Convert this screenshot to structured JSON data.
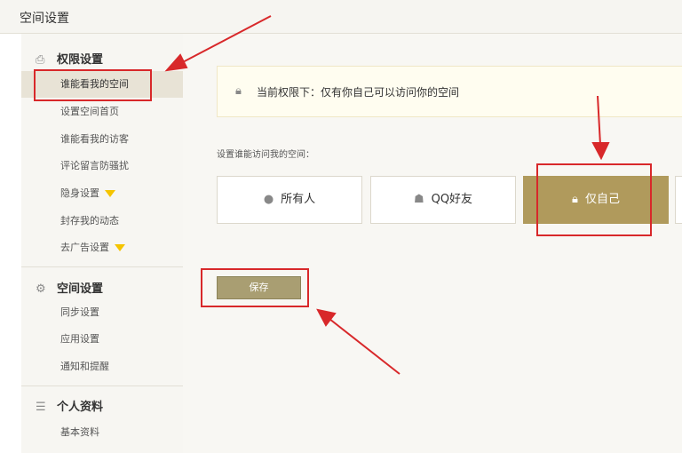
{
  "window": {
    "title": "空间设置"
  },
  "sidebar": {
    "sections": [
      {
        "title": "权限设置",
        "icon": "printer-icon",
        "items": [
          {
            "label": "谁能看我的空间",
            "active": true
          },
          {
            "label": "设置空间首页"
          },
          {
            "label": "谁能看我的访客"
          },
          {
            "label": "评论留言防骚扰"
          },
          {
            "label": "隐身设置",
            "badge": "diamond-icon"
          },
          {
            "label": "封存我的动态"
          },
          {
            "label": "去广告设置",
            "badge": "diamond-icon"
          }
        ]
      },
      {
        "title": "空间设置",
        "icon": "gear-icon",
        "items": [
          {
            "label": "同步设置"
          },
          {
            "label": "应用设置"
          },
          {
            "label": "通知和提醒"
          }
        ]
      },
      {
        "title": "个人资料",
        "icon": "user-list-icon",
        "items": [
          {
            "label": "基本资料"
          }
        ]
      }
    ]
  },
  "main": {
    "notice": {
      "icon": "lock-icon",
      "text": "当前权限下：仅有你自己可以访问你的空间"
    },
    "prompt": "设置谁能访问我的空间：",
    "options": [
      {
        "label": "所有人",
        "icon": "globe-icon",
        "selected": false
      },
      {
        "label": "QQ好友",
        "icon": "users-icon",
        "selected": false
      },
      {
        "label": "仅自己",
        "icon": "lock-icon",
        "selected": true
      }
    ],
    "save_label": "保存"
  },
  "colors": {
    "accent": "#b09a5c",
    "highlight": "#d8282a",
    "save": "#a99e72"
  }
}
